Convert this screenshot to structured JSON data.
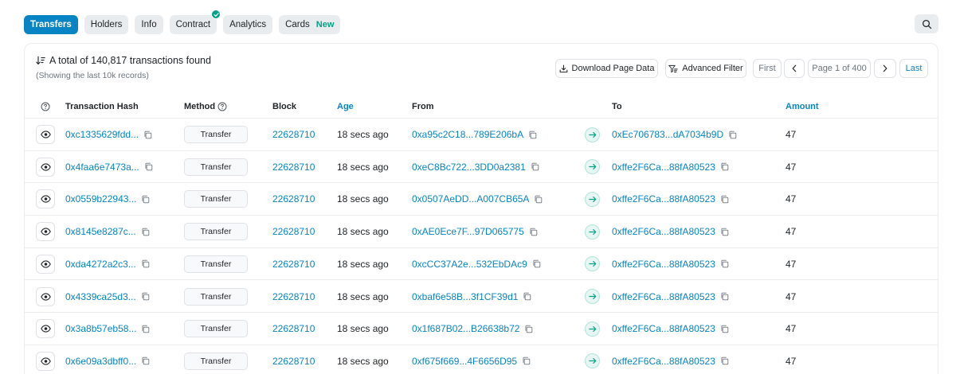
{
  "tabs": [
    {
      "label": "Transfers",
      "active": true
    },
    {
      "label": "Holders"
    },
    {
      "label": "Info"
    },
    {
      "label": "Contract",
      "verified": true
    },
    {
      "label": "Analytics"
    },
    {
      "label": "Cards",
      "badge": "New"
    }
  ],
  "summary": {
    "total": "A total of 140,817 transactions found",
    "note": "(Showing the last 10k records)"
  },
  "toolbar": {
    "download": "Download Page Data",
    "filter": "Advanced Filter",
    "first": "First",
    "page": "Page 1 of 400",
    "last": "Last"
  },
  "columns": {
    "hash": "Transaction Hash",
    "method": "Method",
    "block": "Block",
    "age": "Age",
    "from": "From",
    "to": "To",
    "amount": "Amount"
  },
  "rows": [
    {
      "hash": "0xc1335629fdd...",
      "method": "Transfer",
      "block": "22628710",
      "age": "18 secs ago",
      "from": "0xa95c2C18...789E206bA",
      "to": "0xEc706783...dA7034b9D",
      "amount": "47"
    },
    {
      "hash": "0x4faa6e7473a...",
      "method": "Transfer",
      "block": "22628710",
      "age": "18 secs ago",
      "from": "0xeC8Bc722...3DD0a2381",
      "to": "0xffe2F6Ca...88fA80523",
      "amount": "47"
    },
    {
      "hash": "0x0559b22943...",
      "method": "Transfer",
      "block": "22628710",
      "age": "18 secs ago",
      "from": "0x0507AeDD...A007CB65A",
      "to": "0xffe2F6Ca...88fA80523",
      "amount": "47"
    },
    {
      "hash": "0x8145e8287c...",
      "method": "Transfer",
      "block": "22628710",
      "age": "18 secs ago",
      "from": "0xAE0Ece7F...97D065775",
      "to": "0xffe2F6Ca...88fA80523",
      "amount": "47"
    },
    {
      "hash": "0xda4272a2c3...",
      "method": "Transfer",
      "block": "22628710",
      "age": "18 secs ago",
      "from": "0xcCC37A2e...532EbDAc9",
      "to": "0xffe2F6Ca...88fA80523",
      "amount": "47"
    },
    {
      "hash": "0x4339ca25d3...",
      "method": "Transfer",
      "block": "22628710",
      "age": "18 secs ago",
      "from": "0xbaf6e58B...3f1CF39d1",
      "to": "0xffe2F6Ca...88fA80523",
      "amount": "47"
    },
    {
      "hash": "0x3a8b57eb58...",
      "method": "Transfer",
      "block": "22628710",
      "age": "18 secs ago",
      "from": "0x1f687B02...B26638b72",
      "to": "0xffe2F6Ca...88fA80523",
      "amount": "47"
    },
    {
      "hash": "0x6e09a3dbff0...",
      "method": "Transfer",
      "block": "22628710",
      "age": "18 secs ago",
      "from": "0xf675f669...4F6656D95",
      "to": "0xffe2F6Ca...88fA80523",
      "amount": "47"
    }
  ],
  "icons": {
    "search": "search-icon",
    "sort": "sort-descending-icon",
    "download": "download-icon",
    "filter": "filter-icon",
    "info": "help-circle-icon",
    "eye": "eye-icon",
    "copy": "copy-icon",
    "arrow": "arrow-right-icon",
    "verified": "check-icon"
  },
  "colors": {
    "accent": "#0784c3",
    "success": "#00a186",
    "tab_bg": "#e9ecef",
    "border": "#e9ecef"
  }
}
